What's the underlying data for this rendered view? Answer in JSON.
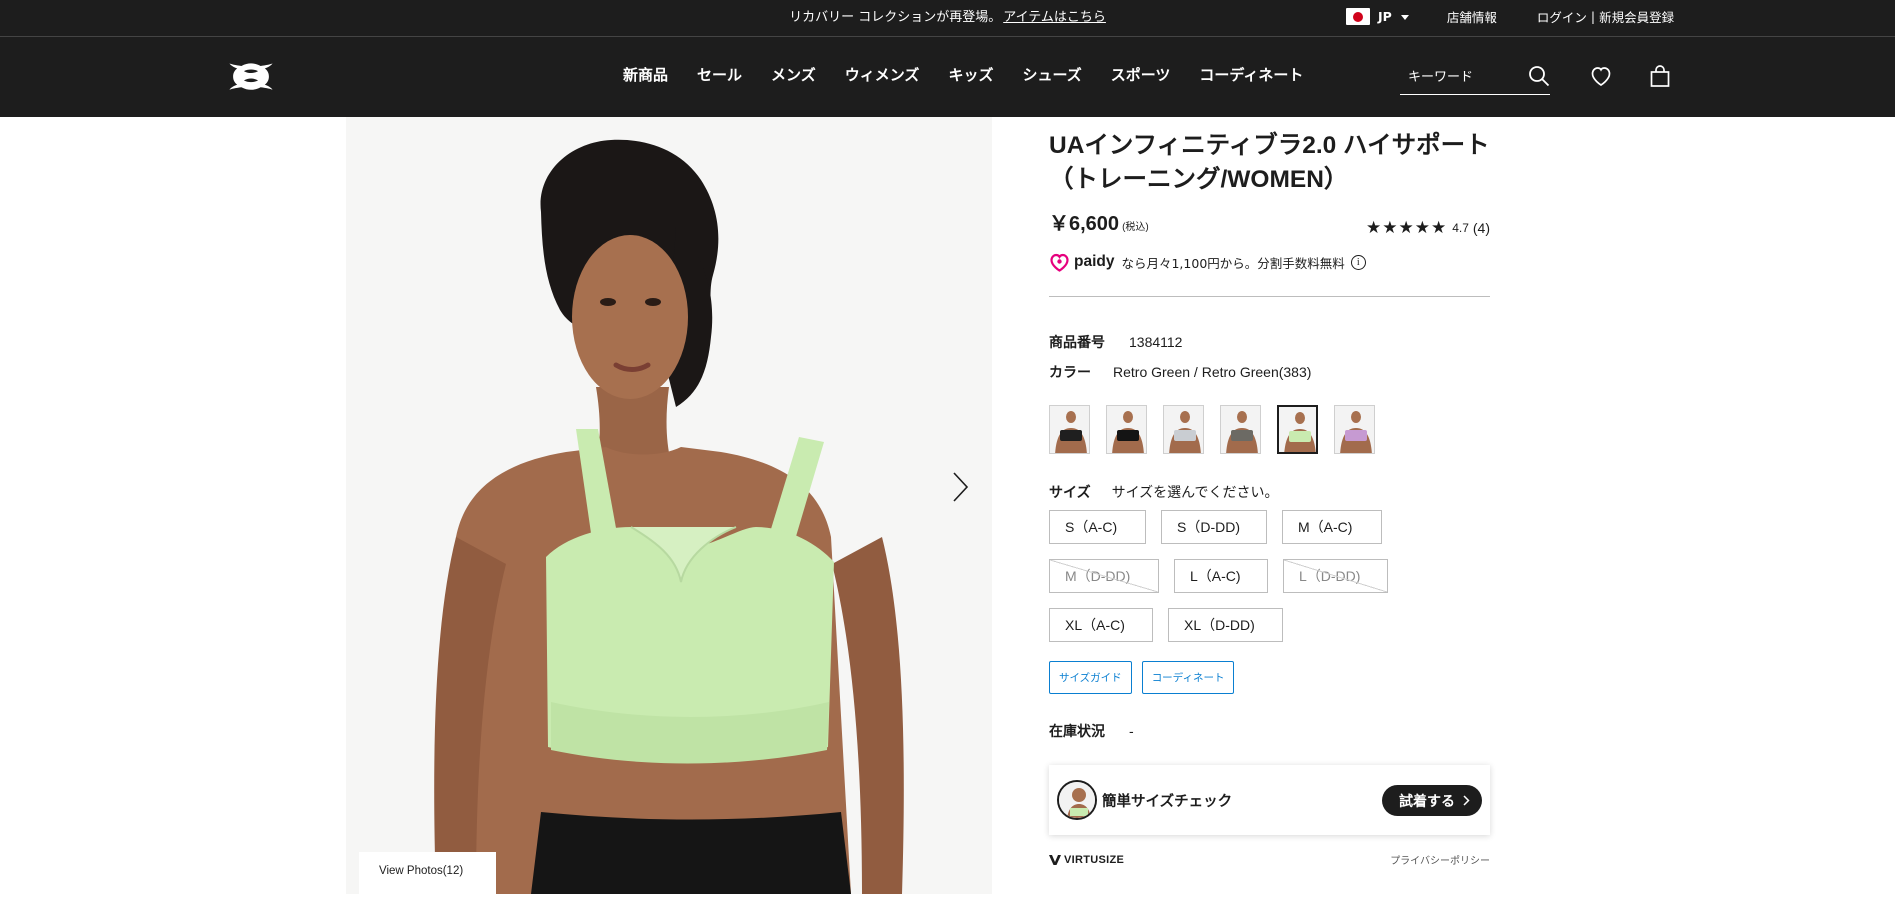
{
  "topbar": {
    "announcement": "リカバリー コレクションが再登場。",
    "announcement_link": "アイテムはこちら",
    "country": "JP",
    "stores": "店舗情報",
    "login": "ログイン",
    "separator": "|",
    "register": "新規会員登録"
  },
  "header": {
    "nav": [
      "新商品",
      "セール",
      "メンズ",
      "ウィメンズ",
      "キッズ",
      "シューズ",
      "スポーツ",
      "コーディネート"
    ],
    "search_placeholder": "キーワード"
  },
  "gallery": {
    "view_photos": "View Photos(12)"
  },
  "product": {
    "title_line1": "UAインフィニティブラ2.0 ハイサポート",
    "title_line2": "（トレーニング/WOMEN）",
    "price": "￥6,600",
    "tax_note": "(税込)",
    "rating_value": "4.7",
    "rating_count": "(4)",
    "rating_stars": 4.7,
    "paidy_word": "paidy",
    "paidy_text": "なら月々1,100円から。分割手数料無料",
    "sku_label": "商品番号",
    "sku": "1384112",
    "color_label": "カラー",
    "color_value": "Retro Green / Retro Green(383)",
    "swatches": [
      {
        "name": "black-light",
        "bra": "#1f1f1f",
        "selected": false
      },
      {
        "name": "black",
        "bra": "#141414",
        "selected": false
      },
      {
        "name": "light-gray",
        "bra": "#c9cdd2",
        "selected": false
      },
      {
        "name": "taupe",
        "bra": "#6c6a64",
        "selected": false
      },
      {
        "name": "retro-green",
        "bra": "#c9ebb0",
        "selected": true
      },
      {
        "name": "lavender",
        "bra": "#c69ad2",
        "selected": false
      }
    ],
    "size_label": "サイズ",
    "size_prompt": "サイズを選んでください。",
    "sizes": [
      {
        "label": "S（A-C)",
        "disabled": false
      },
      {
        "label": "S（D-DD)",
        "disabled": false
      },
      {
        "label": "M（A-C)",
        "disabled": false
      },
      {
        "label": "M（D-DD)",
        "disabled": true
      },
      {
        "label": "L（A-C)",
        "disabled": false
      },
      {
        "label": "L（D-DD)",
        "disabled": true
      },
      {
        "label": "XL（A-C)",
        "disabled": false
      },
      {
        "label": "XL（D-DD)",
        "disabled": false
      }
    ],
    "size_guide": "サイズガイド",
    "coordinate": "コーディネート",
    "stock_label": "在庫状況",
    "stock_value": "-"
  },
  "virtusize": {
    "label": "簡単サイズチェック",
    "button": "試着する",
    "brand": "VIRTUSIZE",
    "privacy": "プライバシーポリシー"
  },
  "colors": {
    "dark": "#1d1d1d",
    "link_blue": "#0a7fd1",
    "paidy_pink": "#e6007e",
    "bra_green": "#c9ebb0"
  }
}
